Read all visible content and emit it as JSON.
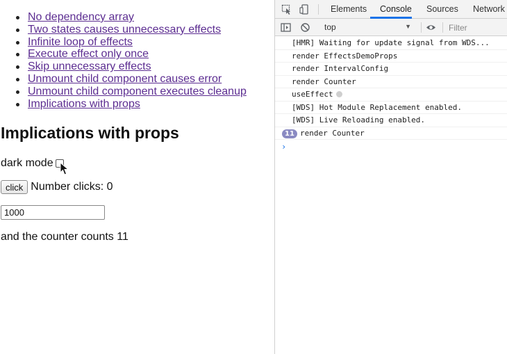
{
  "nav": {
    "links": [
      "No dependency array",
      "Two states causes unnecessary effects",
      "Infinite loop of effects",
      "Execute effect only once",
      "Skip unnecessary effects",
      "Unmount child component causes error",
      "Unmount child component executes cleanup",
      "Implications with props"
    ]
  },
  "main": {
    "heading": "Implications with props",
    "dark_mode_label": "dark mode",
    "dark_mode_checked": false,
    "click_button_label": "click",
    "clicks_text": "Number clicks: 0",
    "interval_value": "1000",
    "counter_text": "and the counter counts 11"
  },
  "devtools": {
    "tabs": [
      "Elements",
      "Console",
      "Sources",
      "Network"
    ],
    "active_tab": "Console",
    "context": "top",
    "filter_placeholder": "Filter",
    "icons": [
      "inspect-element-icon",
      "device-toolbar-icon",
      "sidebar-toggle-icon",
      "clear-console-icon",
      "live-expression-eye-icon"
    ],
    "console_lines": [
      "[HMR] Waiting for update signal from WDS...",
      "render EffectsDemoProps",
      "render IntervalConfig",
      "render Counter",
      "useEffect",
      "[WDS] Hot Module Replacement enabled.",
      "[WDS] Live Reloading enabled.",
      "render Counter"
    ],
    "repeat_count": "11",
    "accent_color": "#1a73e8",
    "badge_color": "#8a8ac2"
  },
  "colors": {
    "link": "#5c2d91",
    "text": "#111111"
  }
}
